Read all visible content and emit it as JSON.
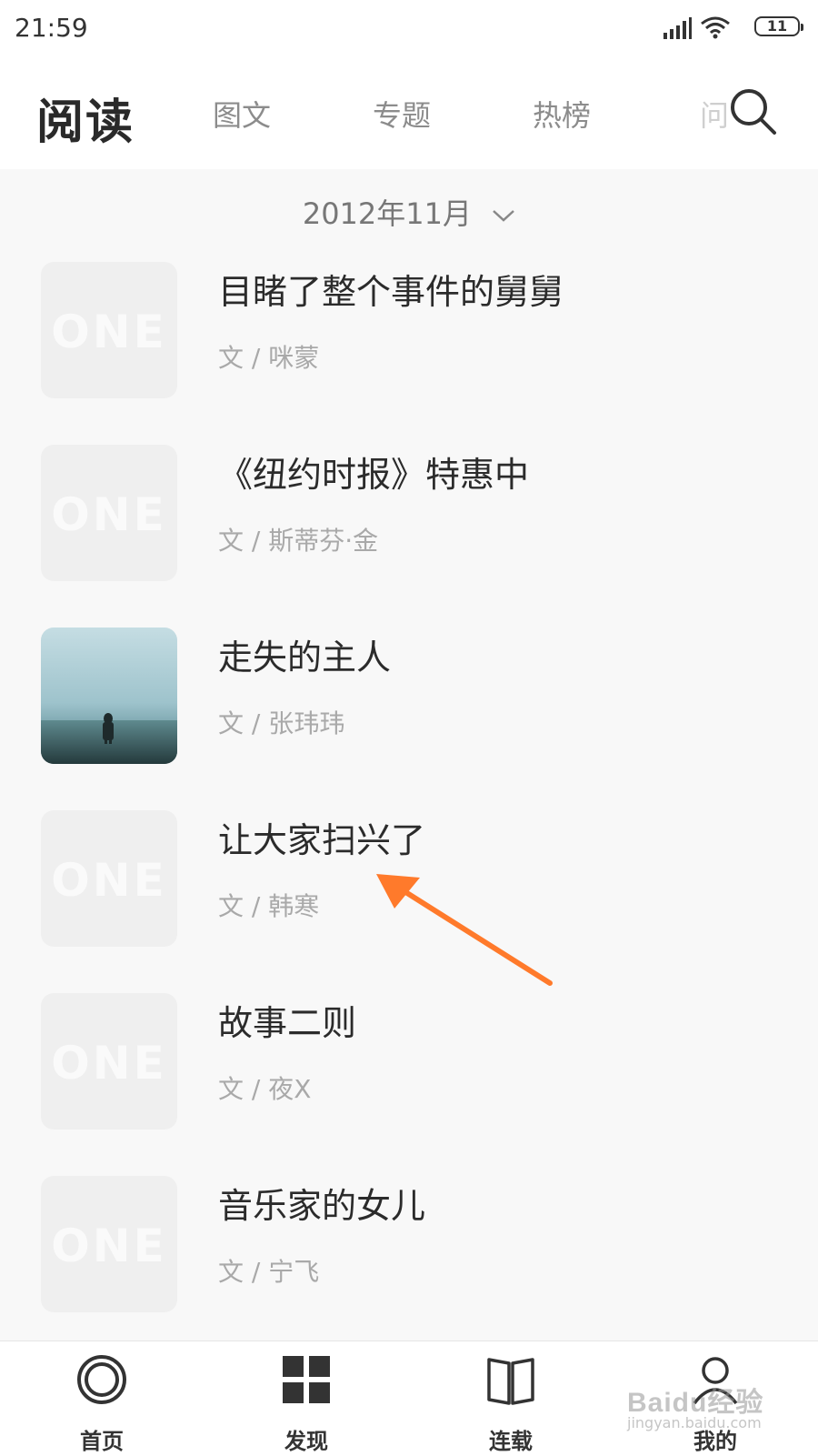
{
  "status_bar": {
    "time": "21:59",
    "battery": "11",
    "icons": [
      "signal-icon",
      "wifi-icon",
      "battery-icon"
    ]
  },
  "header": {
    "title": "阅读",
    "tabs": [
      {
        "label": "图文"
      },
      {
        "label": "专题"
      },
      {
        "label": "热榜"
      },
      {
        "label": "问"
      }
    ],
    "search_icon": "search-icon"
  },
  "date_selector": {
    "value": "2012年11月",
    "icon": "chevron-down-icon"
  },
  "articles": [
    {
      "title": "目睹了整个事件的舅舅",
      "author": "文 / 咪蒙",
      "thumbnail": "ONE"
    },
    {
      "title": "《纽约时报》特惠中",
      "author": "文 / 斯蒂芬·金",
      "thumbnail": "ONE"
    },
    {
      "title": "走失的主人",
      "author": "文 / 张玮玮",
      "thumbnail": "photo"
    },
    {
      "title": "让大家扫兴了",
      "author": "文 / 韩寒",
      "thumbnail": "ONE"
    },
    {
      "title": "故事二则",
      "author": "文 / 夜X",
      "thumbnail": "ONE"
    },
    {
      "title": "音乐家的女儿",
      "author": "文 / 宁飞",
      "thumbnail": "ONE"
    }
  ],
  "bottom_nav": [
    {
      "label": "首页",
      "icon": "home-icon"
    },
    {
      "label": "发现",
      "icon": "grid-icon"
    },
    {
      "label": "连载",
      "icon": "book-icon"
    },
    {
      "label": "我的",
      "icon": "user-icon"
    }
  ],
  "watermark": {
    "text": "Baidu经验",
    "sub": "jingyan.baidu.com"
  },
  "colors": {
    "accent_arrow": "#ff7a2b",
    "background": "#f8f8f8"
  }
}
